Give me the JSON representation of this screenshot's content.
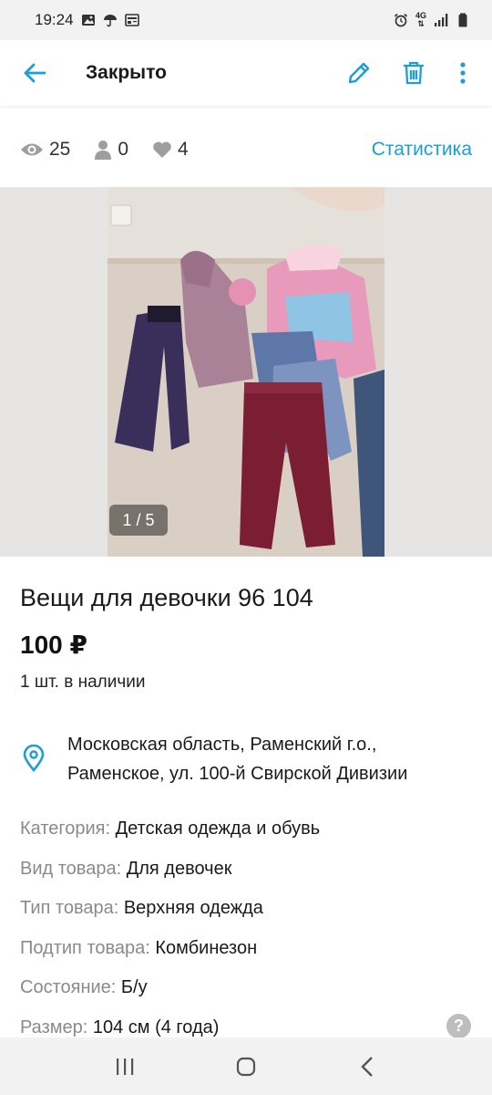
{
  "status_bar": {
    "time": "19:24",
    "network": "4G"
  },
  "app_bar": {
    "title": "Закрыто"
  },
  "stats": {
    "views": "25",
    "contacts": "0",
    "favorites": "4",
    "link": "Статистика"
  },
  "gallery": {
    "counter": "1 / 5"
  },
  "item": {
    "title": "Вещи для девочки 96 104",
    "price": "100 ₽",
    "stock": "1 шт. в наличии",
    "address_line1": "Московская область, Раменский г.о.,",
    "address_line2": "Раменское, ул. 100-й Свирской Дивизии"
  },
  "properties": [
    {
      "key": "Категория:",
      "value": "Детская одежда и обувь"
    },
    {
      "key": "Вид товара:",
      "value": "Для девочек"
    },
    {
      "key": "Тип товара:",
      "value": "Верхняя одежда"
    },
    {
      "key": "Подтип товара:",
      "value": "Комбинезон"
    },
    {
      "key": "Состояние:",
      "value": "Б/у"
    },
    {
      "key": "Размер:",
      "value": "104 см (4 года)"
    }
  ],
  "help": {
    "label": "?"
  },
  "colors": {
    "accent": "#1a9ed8",
    "muted": "#8a8a8a"
  }
}
